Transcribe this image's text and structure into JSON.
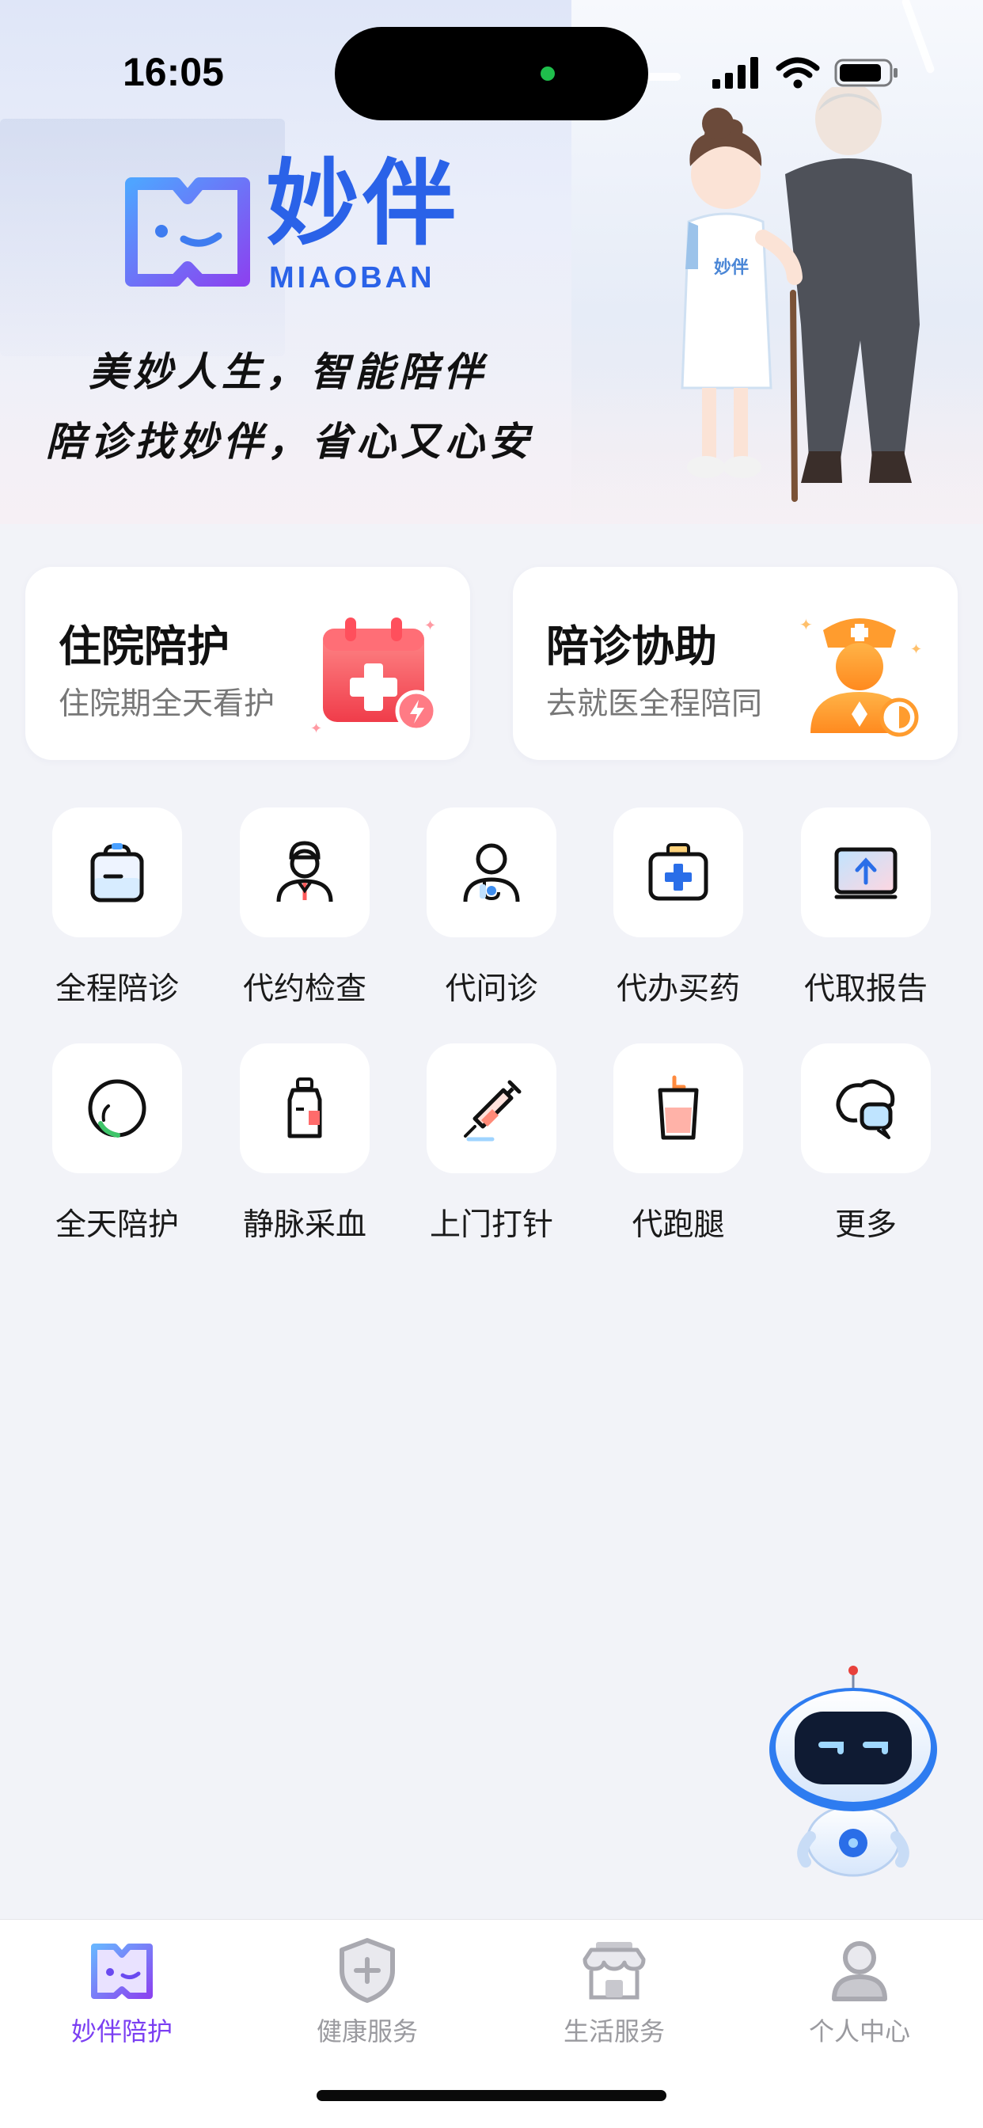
{
  "status_bar": {
    "time": "16:05"
  },
  "hero": {
    "logo_cn": "妙伴",
    "logo_en": "MIAOBAN",
    "slogan_line1": "美妙人生，智能陪伴",
    "slogan_line2": "陪诊找妙伴，省心又心安",
    "badge_text": "妙伴"
  },
  "cards": [
    {
      "title": "住院陪护",
      "subtitle": "住院期全天看护",
      "icon": "calendar-medical-icon"
    },
    {
      "title": "陪诊协助",
      "subtitle": "去就医全程陪同",
      "icon": "nurse-escort-icon"
    }
  ],
  "services": [
    {
      "label": "全程陪诊",
      "icon": "bag-icon"
    },
    {
      "label": "代约检查",
      "icon": "doctor-icon"
    },
    {
      "label": "代问诊",
      "icon": "consult-doctor-icon"
    },
    {
      "label": "代办买药",
      "icon": "medical-kit-icon"
    },
    {
      "label": "代取报告",
      "icon": "report-upload-icon"
    },
    {
      "label": "全天陪护",
      "icon": "clock-circle-icon"
    },
    {
      "label": "静脉采血",
      "icon": "blood-bottle-icon"
    },
    {
      "label": "上门打针",
      "icon": "syringe-icon"
    },
    {
      "label": "代跑腿",
      "icon": "cup-icon"
    },
    {
      "label": "更多",
      "icon": "chat-bubbles-icon"
    }
  ],
  "tabbar": [
    {
      "label": "妙伴陪护",
      "icon": "miaoban-logo-icon",
      "active": true
    },
    {
      "label": "健康服务",
      "icon": "shield-plus-icon",
      "active": false
    },
    {
      "label": "生活服务",
      "icon": "shop-icon",
      "active": false
    },
    {
      "label": "个人中心",
      "icon": "user-icon",
      "active": false
    }
  ],
  "colors": {
    "brand": "#2a62e8",
    "tab_active": "#7b3ff2",
    "background": "#f2f3f8"
  }
}
